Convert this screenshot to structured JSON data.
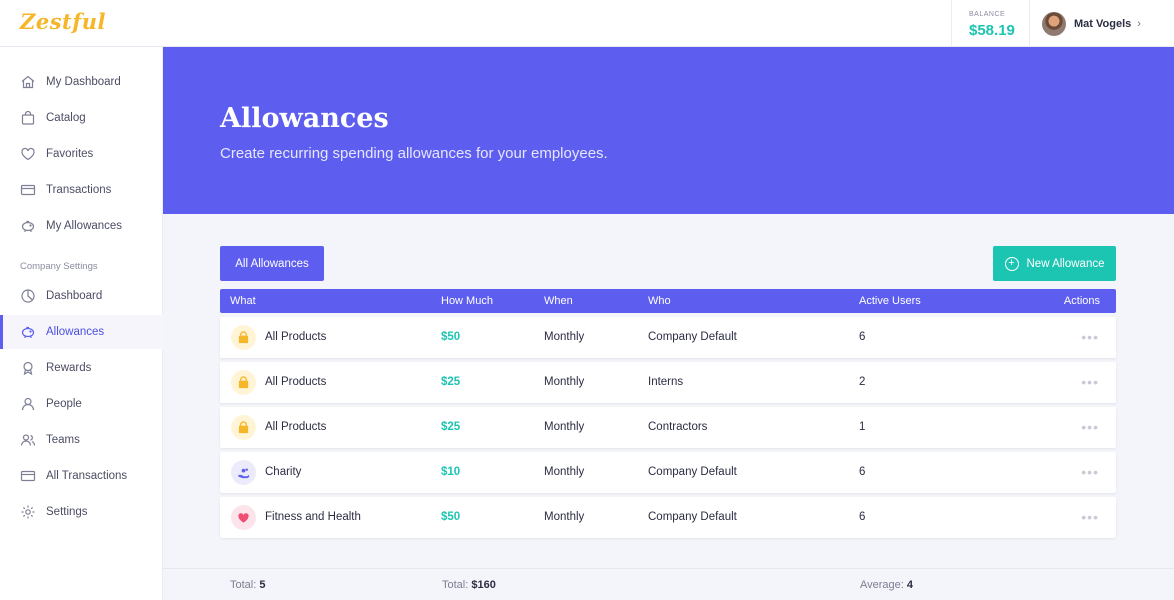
{
  "app": {
    "logo": "Zestful"
  },
  "header": {
    "balance_label": "BALANCE",
    "balance_value": "$58.19",
    "user_name": "Mat Vogels",
    "user_chevron": "›"
  },
  "sidebar": {
    "items": [
      {
        "label": "My Dashboard",
        "icon": "home-icon"
      },
      {
        "label": "Catalog",
        "icon": "bag-icon"
      },
      {
        "label": "Favorites",
        "icon": "heart-icon"
      },
      {
        "label": "Transactions",
        "icon": "card-icon"
      },
      {
        "label": "My Allowances",
        "icon": "piggy-bank-icon"
      }
    ],
    "section_label": "Company Settings",
    "company_items": [
      {
        "label": "Dashboard",
        "icon": "chart-pie-icon"
      },
      {
        "label": "Allowances",
        "icon": "piggy-bank-icon",
        "active": true
      },
      {
        "label": "Rewards",
        "icon": "award-icon"
      },
      {
        "label": "People",
        "icon": "user-icon"
      },
      {
        "label": "Teams",
        "icon": "team-icon"
      },
      {
        "label": "All Transactions",
        "icon": "card-icon"
      },
      {
        "label": "Settings",
        "icon": "gear-icon"
      }
    ]
  },
  "hero": {
    "title": "Allowances",
    "subtitle": "Create recurring spending allowances for your employees."
  },
  "toolbar": {
    "all_label": "All Allowances",
    "new_label": "New Allowance"
  },
  "table": {
    "headers": {
      "what": "What",
      "how_much": "How Much",
      "when": "When",
      "who": "Who",
      "active_users": "Active Users",
      "actions": "Actions"
    },
    "rows": [
      {
        "what": "All Products",
        "icon": "shopping-bag-icon",
        "how_much": "$50",
        "when": "Monthly",
        "who": "Company Default",
        "active_users": "6"
      },
      {
        "what": "All Products",
        "icon": "shopping-bag-icon",
        "how_much": "$25",
        "when": "Monthly",
        "who": "Interns",
        "active_users": "2"
      },
      {
        "what": "All Products",
        "icon": "shopping-bag-icon",
        "how_much": "$25",
        "when": "Monthly",
        "who": "Contractors",
        "active_users": "1"
      },
      {
        "what": "Charity",
        "icon": "charity-hand-icon",
        "how_much": "$10",
        "when": "Monthly",
        "who": "Company Default",
        "active_users": "6"
      },
      {
        "what": "Fitness and Health",
        "icon": "heart-icon",
        "how_much": "$50",
        "when": "Monthly",
        "who": "Company Default",
        "active_users": "6"
      }
    ],
    "actions_glyph": "•••"
  },
  "footer": {
    "total_label": "Total:",
    "total_count": "5",
    "amount_label": "Total:",
    "amount_value": "$160",
    "average_label": "Average:",
    "average_value": "4"
  },
  "colors": {
    "primary": "#5d5ef0",
    "accent": "#1cc4b2",
    "logo": "#f5b62a",
    "bag_bg": "#fff5d6",
    "bag": "#f5b62a",
    "charity_bg": "#ebebfb",
    "charity": "#5d5ef0",
    "heart_bg": "#fde3ea",
    "heart": "#ef4d73"
  }
}
